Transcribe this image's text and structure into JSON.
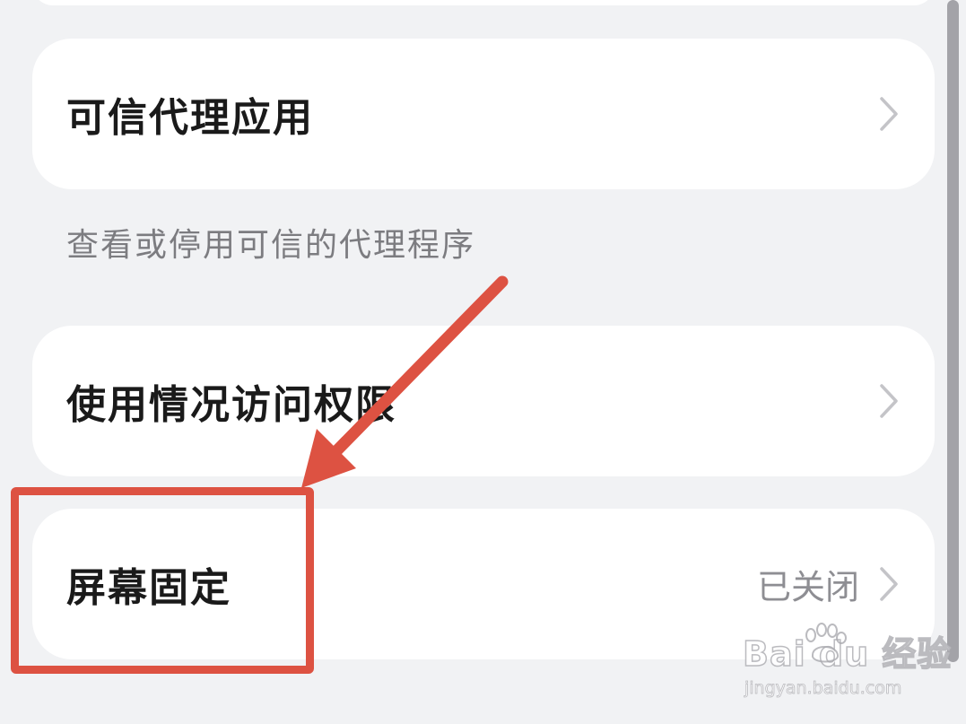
{
  "settings": {
    "rows": [
      {
        "label": "可信代理应用"
      },
      {
        "label": "使用情况访问权限"
      },
      {
        "label": "屏幕固定",
        "status": "已关闭"
      }
    ],
    "notes": {
      "trusted_agents_note": "查看或停用可信的代理程序"
    }
  },
  "annotation": {
    "color": "#dd5242"
  },
  "watermark": {
    "brand": "Bai du 经验",
    "url": "jingyan.baidu.com"
  }
}
